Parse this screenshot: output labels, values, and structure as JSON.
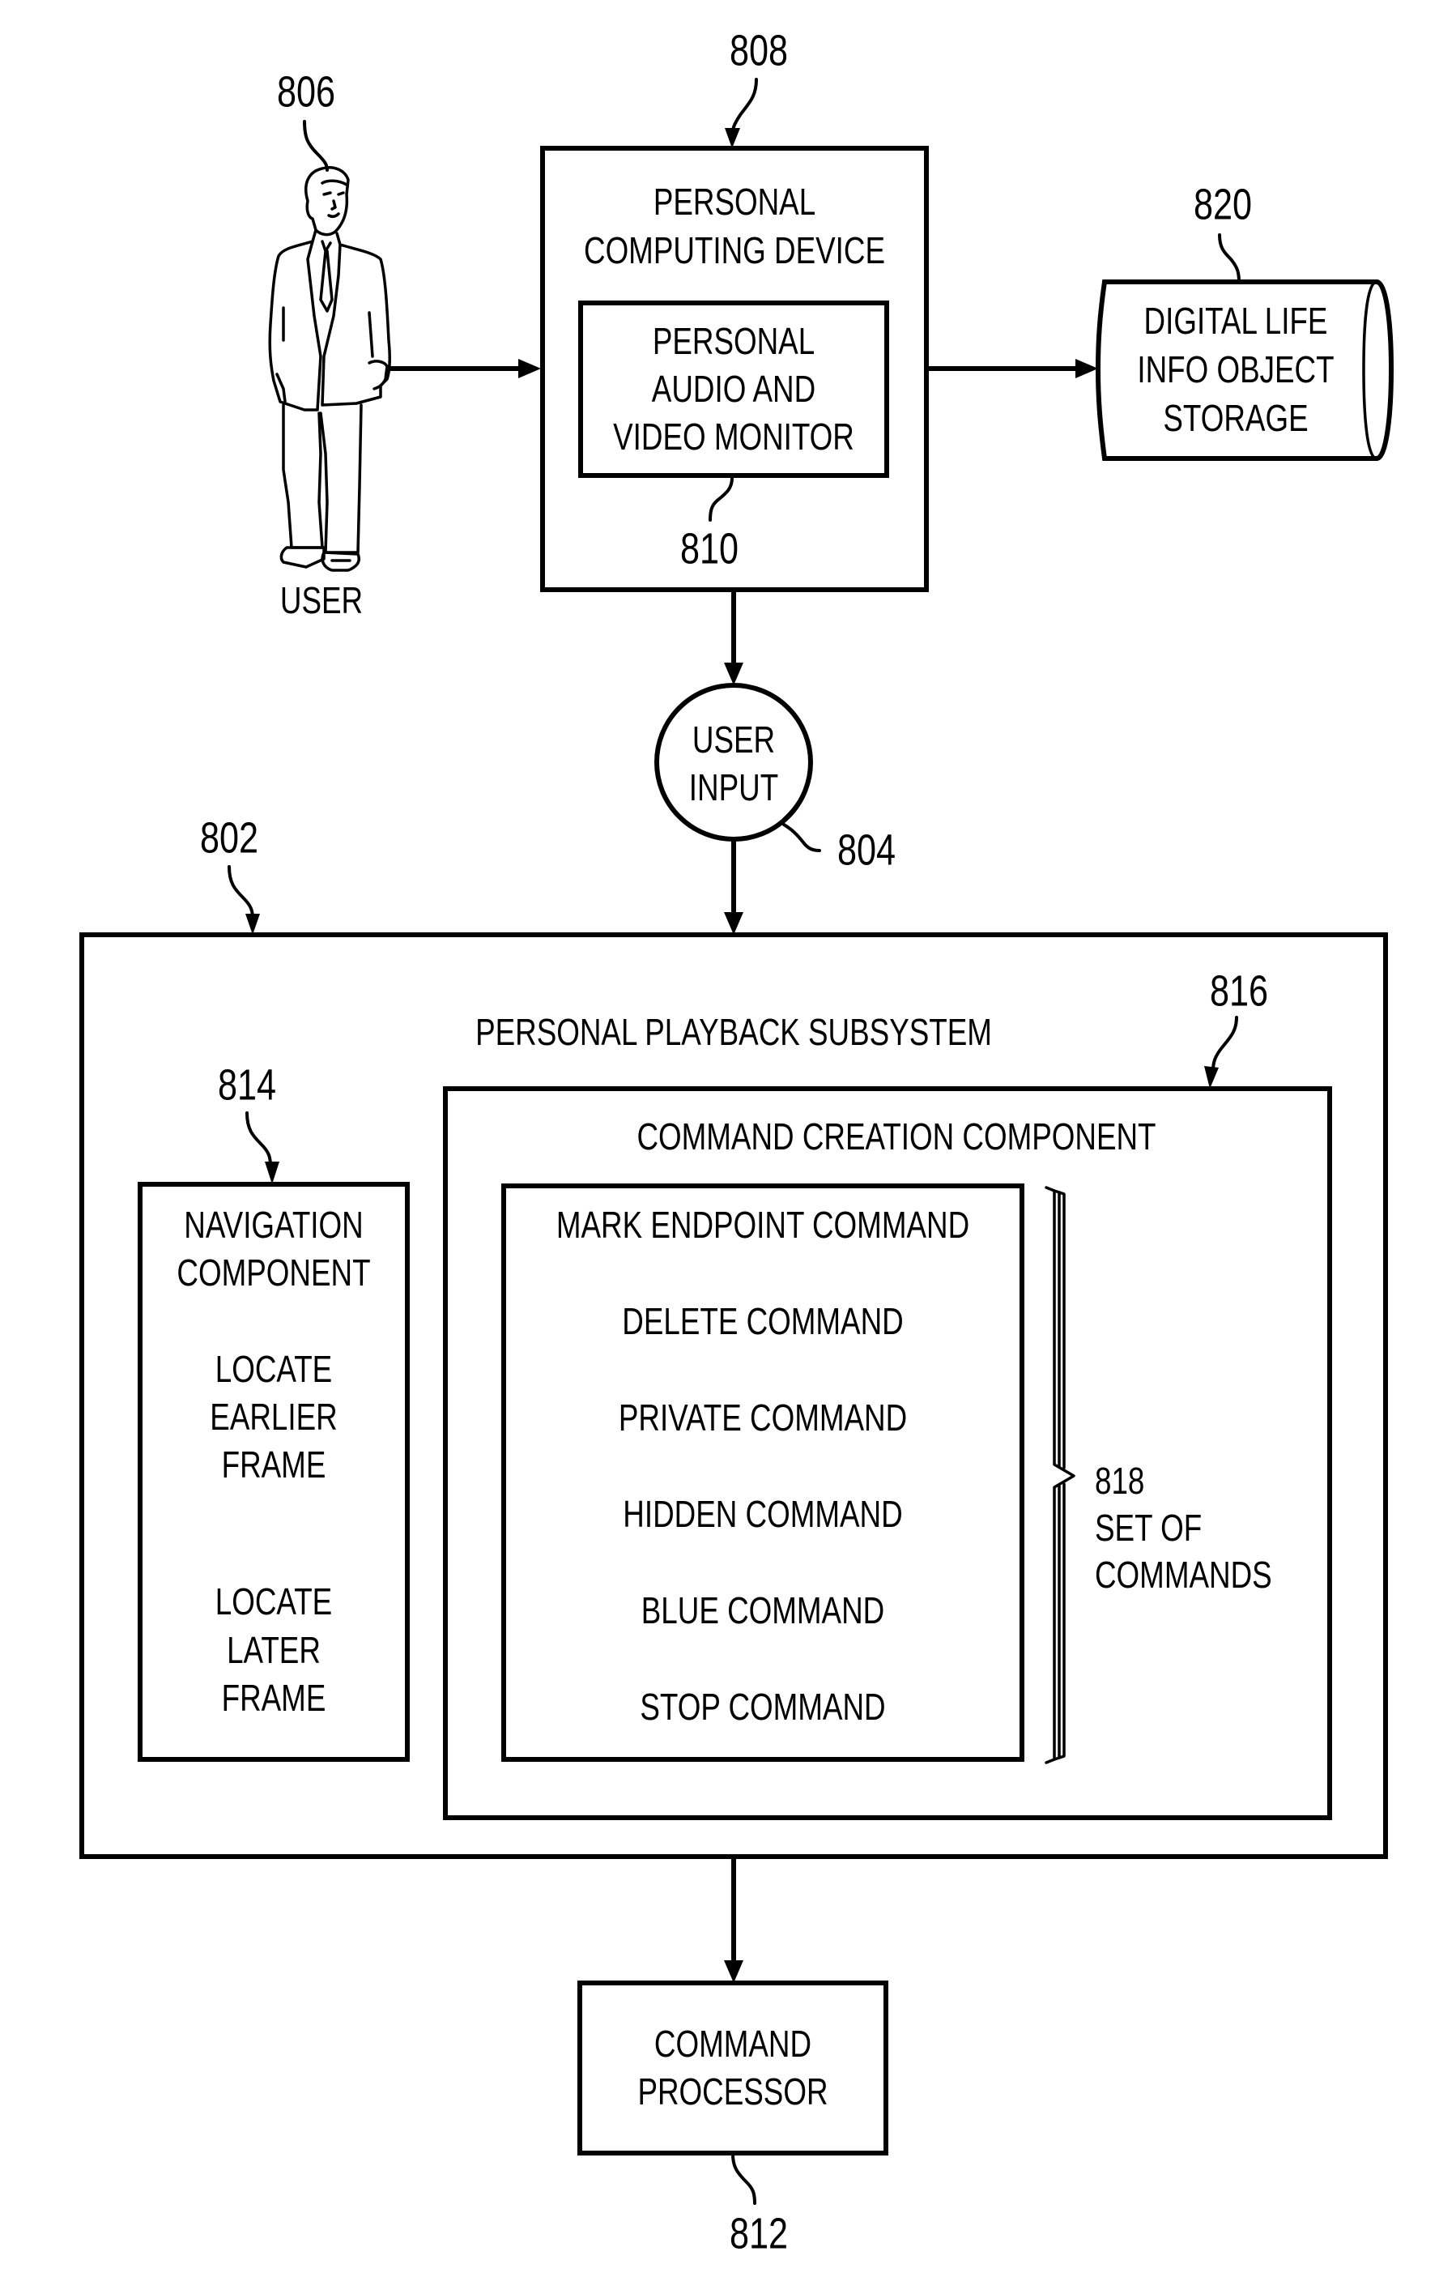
{
  "figure": {
    "user": {
      "ref": "806",
      "label": "USER",
      "icon": "person-in-suit-icon"
    },
    "personal_computing_device": {
      "ref": "808",
      "title_lines": [
        "PERSONAL",
        "COMPUTING DEVICE"
      ],
      "monitor": {
        "ref": "810",
        "lines": [
          "PERSONAL",
          "AUDIO AND",
          "VIDEO MONITOR"
        ]
      }
    },
    "storage": {
      "ref": "820",
      "lines": [
        "DIGITAL LIFE",
        "INFO OBJECT",
        "STORAGE"
      ]
    },
    "user_input": {
      "ref": "804",
      "lines": [
        "USER",
        "INPUT"
      ]
    },
    "playback_subsystem": {
      "ref": "802",
      "title": "PERSONAL PLAYBACK SUBSYSTEM",
      "navigation_component": {
        "ref": "814",
        "title_lines": [
          "NAVIGATION",
          "COMPONENT"
        ],
        "locate_earlier_lines": [
          "LOCATE",
          "EARLIER",
          "FRAME"
        ],
        "locate_later_lines": [
          "LOCATE",
          "LATER",
          "FRAME"
        ]
      },
      "command_creation_component": {
        "ref": "816",
        "title": "COMMAND CREATION COMPONENT",
        "commands": [
          "MARK ENDPOINT COMMAND",
          "DELETE COMMAND",
          "PRIVATE COMMAND",
          "HIDDEN COMMAND",
          "BLUE COMMAND",
          "STOP COMMAND"
        ],
        "set_of_commands": {
          "ref": "818",
          "lines": [
            "SET OF",
            "COMMANDS"
          ]
        }
      }
    },
    "command_processor": {
      "ref": "812",
      "lines": [
        "COMMAND",
        "PROCESSOR"
      ]
    }
  },
  "colors": {
    "ink": "#000000",
    "paper": "#ffffff"
  }
}
